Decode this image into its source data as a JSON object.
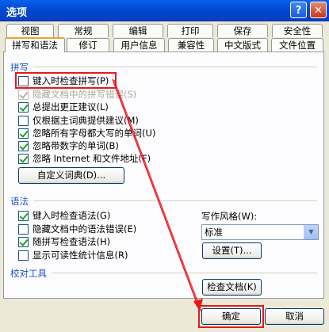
{
  "window": {
    "title": "选项"
  },
  "tabs_row1": [
    "视图",
    "常规",
    "编辑",
    "打印",
    "保存",
    "安全性"
  ],
  "tabs_row2": [
    "拼写和语法",
    "修订",
    "用户信息",
    "兼容性",
    "中文版式",
    "文件位置"
  ],
  "spelling": {
    "label": "拼写",
    "options": [
      {
        "label": "键入时检查拼写(P)",
        "checked": false,
        "disabled": false
      },
      {
        "label": "隐藏文档中的拼写错误(S)",
        "checked": true,
        "disabled": true
      },
      {
        "label": "总提出更正建议(L)",
        "checked": true,
        "disabled": false
      },
      {
        "label": "仅根据主词典提供建议(M)",
        "checked": false,
        "disabled": false
      },
      {
        "label": "忽略所有字母都大写的单词(U)",
        "checked": true,
        "disabled": false
      },
      {
        "label": "忽略带数字的单词(B)",
        "checked": true,
        "disabled": false
      },
      {
        "label": "忽略 Internet 和文件地址(F)",
        "checked": true,
        "disabled": false
      }
    ],
    "custom_dict_button": "自定义词典(D)..."
  },
  "grammar": {
    "label": "语法",
    "options": [
      {
        "label": "键入时检查语法(G)",
        "checked": true
      },
      {
        "label": "隐藏文档中的语法错误(E)",
        "checked": false
      },
      {
        "label": "随拼写检查语法(H)",
        "checked": true
      },
      {
        "label": "显示可读性统计信息(R)",
        "checked": false
      }
    ],
    "style_label": "写作风格(W):",
    "style_value": "标准",
    "settings_button": "设置(T)..."
  },
  "proofing": {
    "label": "校对工具",
    "recheck_button": "检查文档(K)"
  },
  "footer": {
    "ok": "确定",
    "cancel": "取消"
  },
  "colors": {
    "highlight": "#e8181e",
    "titlebar": "#0046d0"
  }
}
